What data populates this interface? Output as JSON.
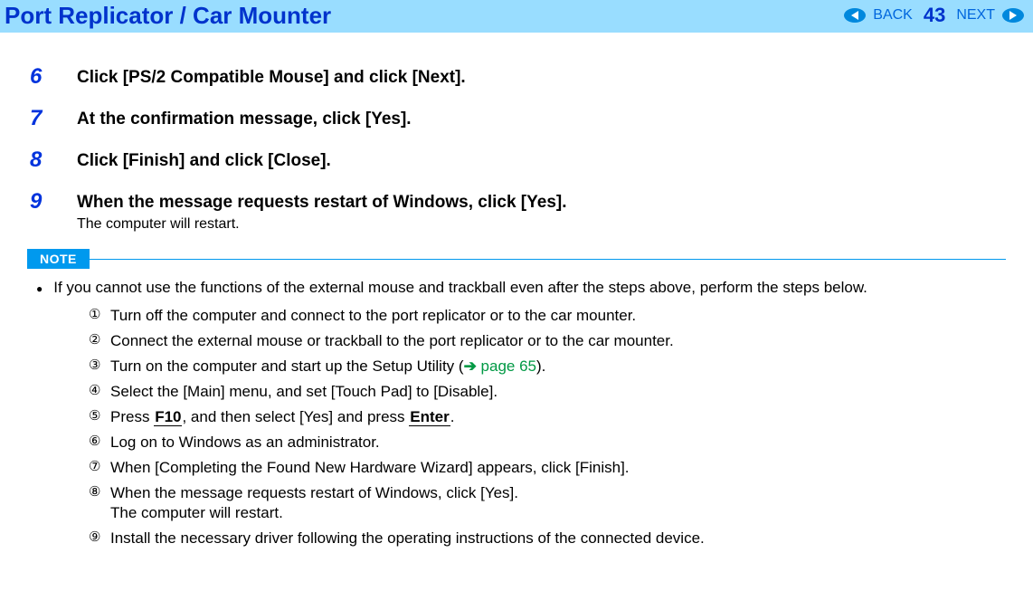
{
  "header": {
    "title": "Port Replicator / Car Mounter",
    "back": "BACK",
    "next": "NEXT",
    "page": "43"
  },
  "steps": [
    {
      "num": "6",
      "label": "Click [PS/2 Compatible Mouse] and click [Next]."
    },
    {
      "num": "7",
      "label": "At the confirmation message, click [Yes]."
    },
    {
      "num": "8",
      "label": "Click [Finish] and click [Close]."
    },
    {
      "num": "9",
      "label": "When the message requests restart of Windows, click [Yes].",
      "sub": "The computer will restart."
    }
  ],
  "note_label": "NOTE",
  "bullet": "If you cannot use the functions of the external mouse and trackball even after the steps above, perform the steps below.",
  "sublist": {
    "1": "Turn off the computer and connect to the port replicator or to the car mounter.",
    "2": "Connect the external mouse or trackball to the port replicator or to the car mounter.",
    "3_pre": "Turn on the computer and start up the Setup Utility (",
    "3_arrow": "➔",
    "3_link": " page 65",
    "3_post": ").",
    "4": "Select the [Main] menu, and set [Touch Pad] to [Disable].",
    "5_pre": "Press ",
    "5_key1": "F10",
    "5_mid": ", and then select [Yes] and press ",
    "5_key2": "Enter",
    "5_post": ".",
    "6": "Log on to Windows as an administrator.",
    "7": "When [Completing the Found New Hardware Wizard] appears, click [Finish].",
    "8a": "When the message requests restart of Windows, click [Yes].",
    "8b": "The computer will restart.",
    "9": "Install the necessary driver following the operating instructions of the connected device."
  },
  "circled": {
    "1": "①",
    "2": "②",
    "3": "③",
    "4": "④",
    "5": "⑤",
    "6": "⑥",
    "7": "⑦",
    "8": "⑧",
    "9": "⑨"
  }
}
